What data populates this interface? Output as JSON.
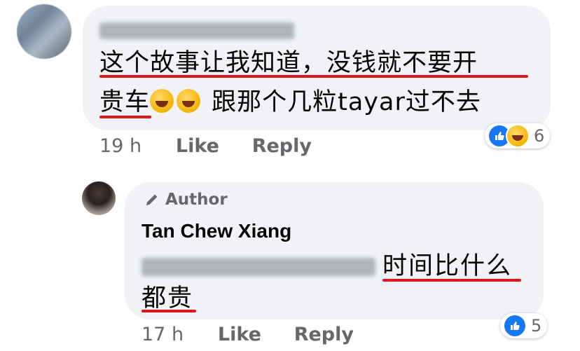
{
  "comments": [
    {
      "author_name": "Peggy Lee Phei Di",
      "text_line1": "这个故事让我知道，没钱就不要开",
      "text_line2_a": "贵车",
      "text_line2_b": " 跟那个几粒tayar过不去",
      "time": "19 h",
      "like_label": "Like",
      "reply_label": "Reply",
      "reactions": [
        "like-icon",
        "haha-icon"
      ],
      "reaction_count": "6"
    },
    {
      "badge": "Author",
      "author_name": "Tan Chew Xiang",
      "mention": "Peggy Lee Phei Di",
      "text_line1": "时间比什么",
      "text_line2": "都贵",
      "time": "17 h",
      "like_label": "Like",
      "reply_label": "Reply",
      "reactions": [
        "like-icon"
      ],
      "reaction_count": "5"
    }
  ],
  "colors": {
    "bubble_bg": "#f0f2f5",
    "underline_red": "#e0161b",
    "meta_gray": "#65676b",
    "like_blue": "#1877f2"
  }
}
